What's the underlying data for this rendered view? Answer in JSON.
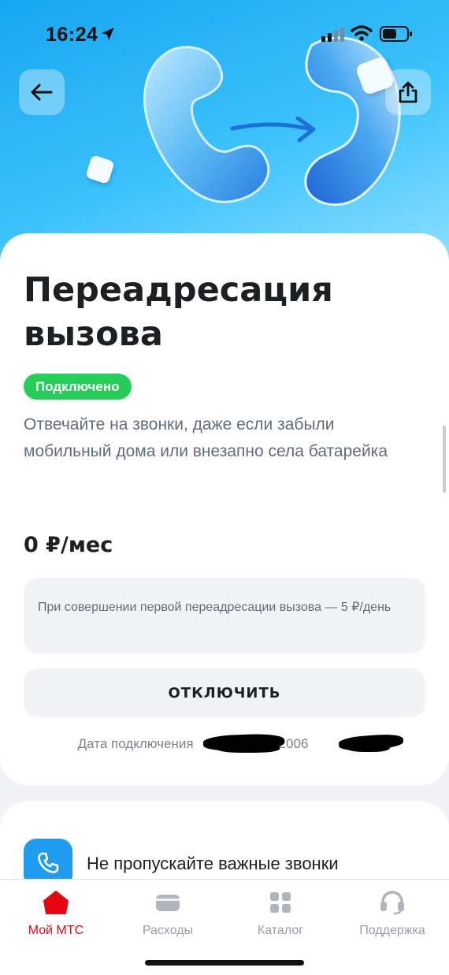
{
  "status_bar": {
    "time": "16:24"
  },
  "header": {
    "back_icon": "arrow-left-icon",
    "share_icon": "share-icon"
  },
  "service": {
    "title_line1": "Переадресация",
    "title_line2": "вызова",
    "status_badge": "Подключено",
    "description": "Отвечайте на звонки, даже если забыли мобильный дома или внезапно села батарейка",
    "price": "0 ₽/мес",
    "note": "При совершении первой переадресации вызова — 5 ₽/день",
    "disconnect_label": "ОТКЛЮЧИТЬ",
    "connection_date_prefix": "Дата подключения",
    "connection_date_visible_year": "2006"
  },
  "feature": {
    "icon": "phone-icon",
    "text": "Не пропускайте важные звонки"
  },
  "tabbar": {
    "tabs": [
      {
        "label": "Мой МТС",
        "icon": "home-icon",
        "active": true
      },
      {
        "label": "Расходы",
        "icon": "wallet-icon",
        "active": false
      },
      {
        "label": "Каталог",
        "icon": "grid-icon",
        "active": false
      },
      {
        "label": "Поддержка",
        "icon": "headset-icon",
        "active": false
      }
    ]
  },
  "colors": {
    "accent": "#e30611",
    "badge_green": "#26cd58",
    "hero_blue": "#18a6f2",
    "feature_blue": "#1f9bf0"
  }
}
